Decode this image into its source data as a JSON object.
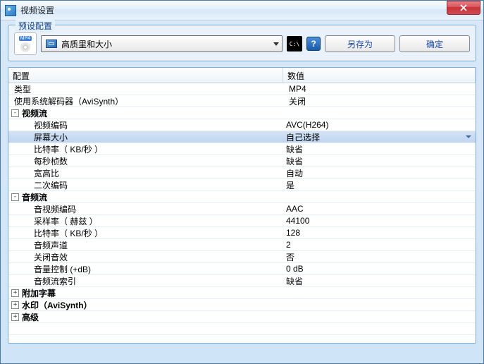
{
  "window": {
    "title": "视频设置"
  },
  "preset": {
    "legend": "预设配置",
    "icon_tag": "MP4",
    "combo_value": "高质里和大小",
    "save_as_label": "另存为",
    "ok_label": "确定",
    "help_label": "?",
    "cmd_label": "C:\\"
  },
  "grid": {
    "header_config": "配置",
    "header_value": "数值",
    "rows": [
      {
        "type": "leaf",
        "indent": 0,
        "label": "类型",
        "value": "MP4"
      },
      {
        "type": "leaf",
        "indent": 0,
        "label": "使用系统解码器（AviSynth）",
        "value": "关闭"
      },
      {
        "type": "group",
        "state": "-",
        "label": "视频流",
        "bold": true
      },
      {
        "type": "leaf",
        "indent": 2,
        "label": "视频编码",
        "value": "AVC(H264)"
      },
      {
        "type": "leaf",
        "indent": 2,
        "label": "屏幕大小",
        "value": "自己选择",
        "selected": true
      },
      {
        "type": "leaf",
        "indent": 2,
        "label": "比特率（ KB/秒 ）",
        "value": "缺省"
      },
      {
        "type": "leaf",
        "indent": 2,
        "label": "每秒桢数",
        "value": "缺省"
      },
      {
        "type": "leaf",
        "indent": 2,
        "label": "宽高比",
        "value": "自动"
      },
      {
        "type": "leaf",
        "indent": 2,
        "label": "二次编码",
        "value": "是"
      },
      {
        "type": "group",
        "state": "-",
        "label": "音频流",
        "bold": true
      },
      {
        "type": "leaf",
        "indent": 2,
        "label": "音视频编码",
        "value": "AAC"
      },
      {
        "type": "leaf",
        "indent": 2,
        "label": "采样率（ 赫兹 ）",
        "value": "44100"
      },
      {
        "type": "leaf",
        "indent": 2,
        "label": "比特率（ KB/秒 ）",
        "value": "128"
      },
      {
        "type": "leaf",
        "indent": 2,
        "label": "音频声道",
        "value": "2"
      },
      {
        "type": "leaf",
        "indent": 2,
        "label": "关闭音效",
        "value": "否"
      },
      {
        "type": "leaf",
        "indent": 2,
        "label": "音量控制 (+dB)",
        "value": "0 dB"
      },
      {
        "type": "leaf",
        "indent": 2,
        "label": "音频流索引",
        "value": "缺省"
      },
      {
        "type": "group",
        "state": "+",
        "label": "附加字幕",
        "bold": true
      },
      {
        "type": "group",
        "state": "+",
        "label": "水印（AviSynth）",
        "bold": true
      },
      {
        "type": "group",
        "state": "+",
        "label": "高级",
        "bold": true
      },
      {
        "type": "blank"
      }
    ]
  }
}
